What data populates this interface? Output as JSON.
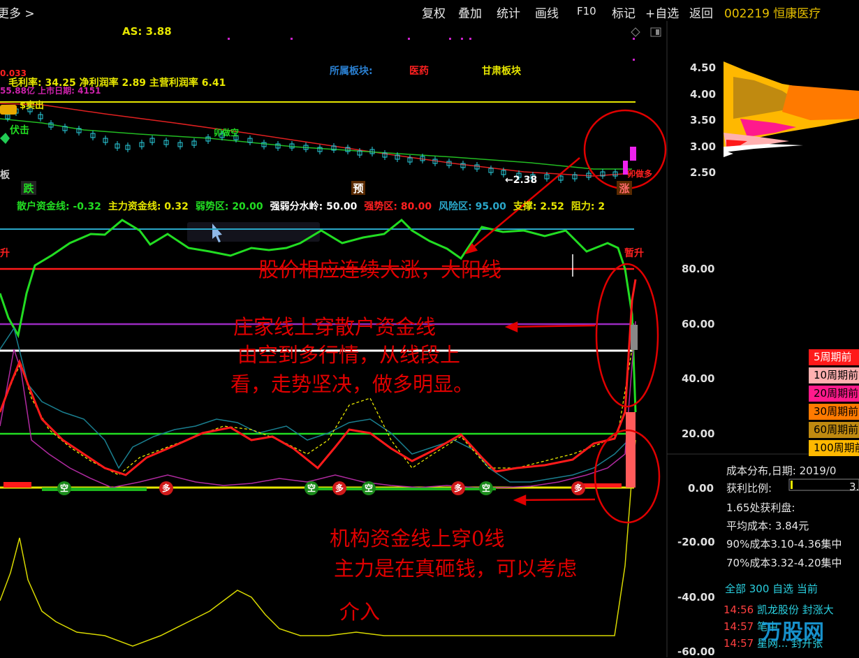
{
  "toolbar": {
    "more": "更多 >",
    "items": [
      "复权",
      "叠加",
      "统计",
      "画线",
      "F10",
      "标记",
      "+自选",
      "返回"
    ],
    "stock": "002219 恒康医疗"
  },
  "price_panel": {
    "as": "AS: 3.88",
    "sector_label": "所属板块:",
    "sector_1": "医药",
    "sector_2": "甘肃板块",
    "fundamentals": "毛利率: 34.25 净利润率 2.89 主营利润率 6.41",
    "left_red_1": "0.033",
    "left_red_2": "55.88亿 上市日期: 4151",
    "marker_shimai": "$卖出",
    "marker_fuji": "伏击",
    "marker_kongduo": "卯做空",
    "marker_zuoduo": "卯做多",
    "low_price": "←2.38",
    "tag_die": "跌",
    "tag_yu": "预",
    "tag_zhang": "涨",
    "tag_ban": "板",
    "price_ticks": [
      "4.50",
      "4.00",
      "3.50",
      "3.00",
      "2.50"
    ]
  },
  "indicator_panel": {
    "header": [
      {
        "text": "散户资金线: -0.32",
        "color": "#22dd22"
      },
      {
        "text": "主力资金线: 0.32",
        "color": "#e6e600"
      },
      {
        "text": "弱势区: 20.00",
        "color": "#22dd22"
      },
      {
        "text": "强弱分水岭: 50.00",
        "color": "#ffffff"
      },
      {
        "text": "强势区: 80.00",
        "color": "#ff2020"
      },
      {
        "text": "风险区: 95.00",
        "color": "#2aa7c9"
      },
      {
        "text": "支撑: 2.52",
        "color": "#e6e600"
      },
      {
        "text": "阻力: 2",
        "color": "#e6e600"
      }
    ],
    "axis_ticks": [
      "80.00",
      "60.00",
      "40.00",
      "20.00",
      "0.00",
      "-20.00",
      "-40.00",
      "-60.00"
    ],
    "left_tag": "升",
    "right_tag": "暂升",
    "kong": "空",
    "duo": "多"
  },
  "annotations": {
    "a1": "股价相应连续大涨，大阳线",
    "a2": "庄家线上穿散户资金线",
    "a3": "由空到多行情，从线段上",
    "a4": "看，走势坚决，做多明显。",
    "a5": "机构资金线上穿0线",
    "a6": "主力是在真砸钱，可以考虑",
    "a7": "介入"
  },
  "side_panel": {
    "legend": [
      {
        "label": "5周期前",
        "bg": "#ff1a1a",
        "fg": "#ffffff"
      },
      {
        "label": "10周期前",
        "bg": "#ffb0b0",
        "fg": "#000000"
      },
      {
        "label": "20周期前",
        "bg": "#ff1a8c",
        "fg": "#000000"
      },
      {
        "label": "30周期前",
        "bg": "#ff7a00",
        "fg": "#000000"
      },
      {
        "label": "60周期前",
        "bg": "#c08a10",
        "fg": "#000000"
      },
      {
        "label": "100周期前",
        "bg": "#ffb800",
        "fg": "#000000"
      }
    ],
    "cost_date": "成本分布,日期: 2019/0",
    "profit_ratio_label": "获利比例:",
    "profit_ratio_value": "3.",
    "profit_at": "1.65处获利盘:",
    "avg_cost": "平均成本: 3.84元",
    "c90": "90%成本3.10-4.36集中",
    "c70": "70%成本3.32-4.20集中",
    "list_tabs": "全部 300 自选 当前",
    "list_rows": [
      {
        "time": "14:56",
        "name": "凯龙股份",
        "status": "封涨大"
      },
      {
        "time": "14:57",
        "name": "",
        "status": "笔中"
      },
      {
        "time": "14:57",
        "name": "星网...",
        "status": "封开张"
      }
    ],
    "watermark": "万股网"
  },
  "colors": {
    "green": "#22dd22",
    "red": "#ff1a1a",
    "yellow": "#e6e600",
    "cyan": "#2aa7c9",
    "magenta": "#cc22aa",
    "white": "#ffffff",
    "annotation": "#e00000"
  }
}
